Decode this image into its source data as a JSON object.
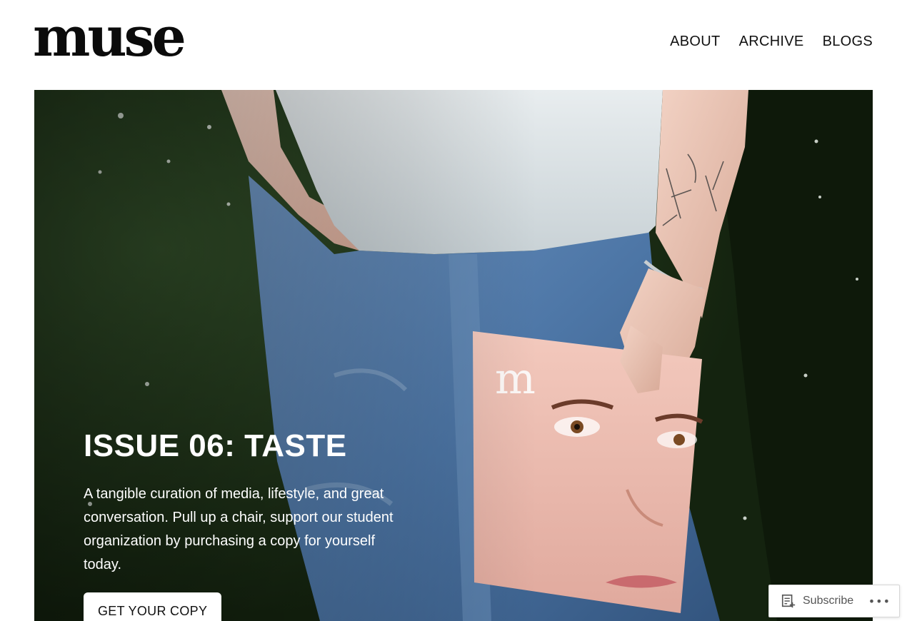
{
  "site": {
    "logo": "muse"
  },
  "nav": {
    "items": [
      {
        "label": "ABOUT"
      },
      {
        "label": "ARCHIVE"
      },
      {
        "label": "BLOGS"
      }
    ]
  },
  "hero": {
    "title": "ISSUE 06: TASTE",
    "description": "A tangible curation of media, lifestyle, and great conversation. Pull up a chair, support our student organization by purchasing a copy for yourself today.",
    "cta_label": "GET YOUR COPY",
    "image_colors": {
      "grass": "#1f3317",
      "jeans": "#4f78a8",
      "shirt": "#dfe5e8",
      "magazine": "#eebcae"
    }
  },
  "subscribe": {
    "label": "Subscribe",
    "more_label": "•••",
    "icon": "reader-subscribe-icon"
  }
}
